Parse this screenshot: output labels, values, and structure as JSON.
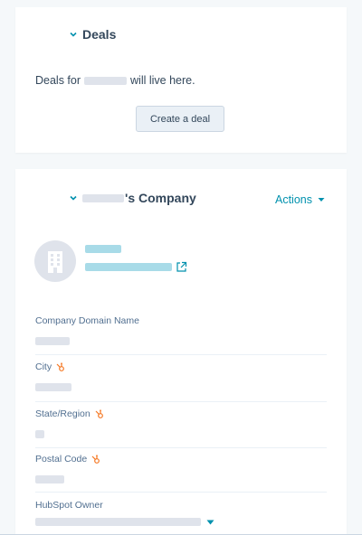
{
  "deals_card": {
    "title": "Deals",
    "text_before": "Deals for",
    "text_after": "will live here.",
    "create_button": "Create a deal"
  },
  "company_card": {
    "title_suffix": "'s Company",
    "actions_label": "Actions",
    "properties": [
      {
        "label": "Company Domain Name",
        "has_sync_icon": false
      },
      {
        "label": "City",
        "has_sync_icon": true
      },
      {
        "label": "State/Region",
        "has_sync_icon": true
      },
      {
        "label": "Postal Code",
        "has_sync_icon": true
      },
      {
        "label": "HubSpot Owner",
        "has_sync_icon": false
      }
    ]
  },
  "colors": {
    "accent": "#0091ae",
    "text": "#33475b",
    "muted": "#516f90",
    "redacted": "#dfe3eb",
    "redacted_link": "#a8dbe8"
  },
  "icons": [
    "chevron-down-icon",
    "caret-down-icon",
    "building-icon",
    "external-link-icon",
    "hubspot-sync-icon"
  ]
}
